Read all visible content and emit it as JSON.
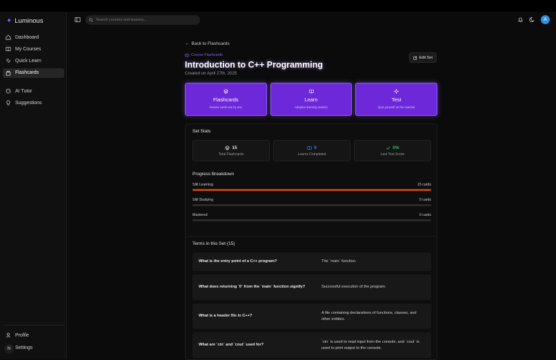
{
  "app": {
    "name": "Luminous"
  },
  "sidebar": {
    "items": [
      {
        "label": "Dashboard",
        "icon": "home-icon",
        "active": false
      },
      {
        "label": "My Courses",
        "icon": "book-open-icon",
        "active": false
      },
      {
        "label": "Quick Learn",
        "icon": "zap-icon",
        "active": false
      },
      {
        "label": "Flashcards",
        "icon": "layers-icon",
        "active": true
      },
      {
        "label": "AI Tutor",
        "icon": "robot-icon",
        "active": false
      },
      {
        "label": "Suggestions",
        "icon": "lightbulb-icon",
        "active": false
      }
    ],
    "bottom": [
      {
        "label": "Profile",
        "icon": "user-icon"
      },
      {
        "label": "Settings",
        "icon": "gear-icon"
      }
    ],
    "badge": "N"
  },
  "header": {
    "search_placeholder": "Search courses and lessons...",
    "avatar_initial": "A"
  },
  "page": {
    "back_label": "Back to Flashcards",
    "kind_label": "Course Flashcards",
    "title": "Introduction to C++ Programming",
    "created": "Created on April 27th, 2025",
    "edit_label": "Edit Set"
  },
  "modes": [
    {
      "title": "Flashcards",
      "subtitle": "Review cards one by one",
      "icon": "layers-icon"
    },
    {
      "title": "Learn",
      "subtitle": "Adaptive learning session",
      "icon": "book-open-icon"
    },
    {
      "title": "Test",
      "subtitle": "Quiz yourself on the material",
      "icon": "sparkle-icon"
    }
  ],
  "stats": {
    "title": "Set Stats",
    "items": [
      {
        "value": "15",
        "label": "Total Flashcards",
        "icon": "layers-icon",
        "color": "#f0f0f0"
      },
      {
        "value": "0",
        "label": "Learns Completed",
        "icon": "book-open-icon",
        "color": "#3b82f6"
      },
      {
        "value": "0%",
        "label": "Last Test Score",
        "icon": "check-icon",
        "color": "#22c55e"
      }
    ]
  },
  "progress": {
    "title": "Progress Breakdown",
    "items": [
      {
        "label": "Still Learning",
        "count": "15 cards",
        "fraction": 1.0,
        "color": "#c2410c"
      },
      {
        "label": "Still Studying",
        "count": "0 cards",
        "fraction": 0.0,
        "color": "#eab308"
      },
      {
        "label": "Mastered",
        "count": "0 cards",
        "fraction": 0.0,
        "color": "#22c55e"
      }
    ]
  },
  "terms": {
    "title": "Terms in this Set (15)",
    "items": [
      {
        "term": "What is the entry point of a C++ program?",
        "definition": "The `main` function."
      },
      {
        "term": "What does returning `0` from the `main` function signify?",
        "definition": "Successful execution of the program."
      },
      {
        "term": "What is a header file in C++?",
        "definition": "A file containing declarations of functions, classes, and other entities."
      },
      {
        "term": "What are `cin` and `cout` used for?",
        "definition": "`cin` is used to read input from the console, and `cout` is used to print output to the console."
      }
    ]
  }
}
